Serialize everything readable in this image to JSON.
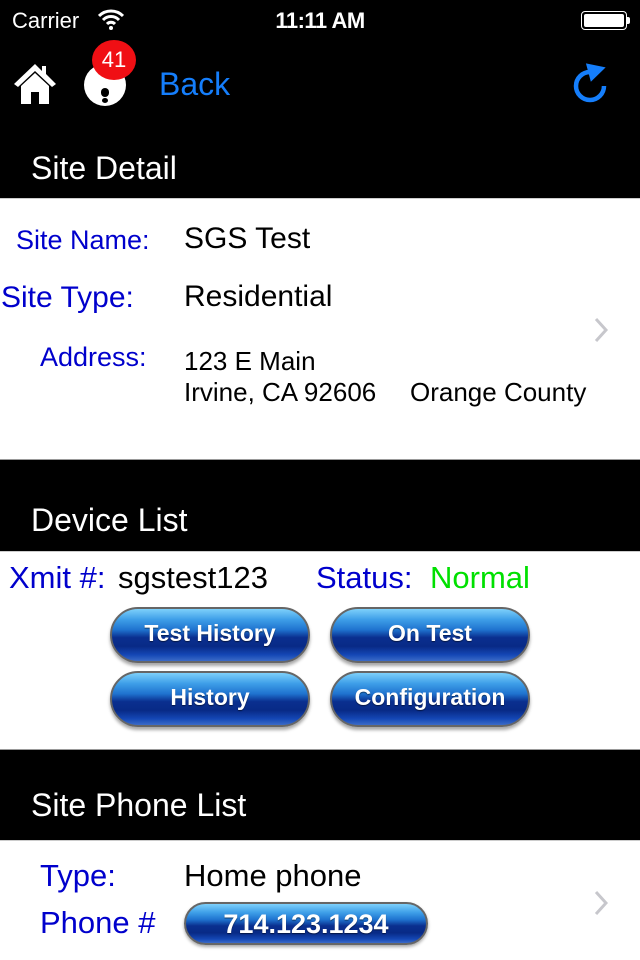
{
  "status_bar": {
    "carrier": "Carrier",
    "time": "11:11 AM",
    "wifi_icon": "wifi-icon",
    "battery_icon": "battery-icon"
  },
  "nav": {
    "home_icon": "home-icon",
    "alert_icon": "alert-icon",
    "alert_badge": "41",
    "back_label": "Back",
    "refresh_icon": "refresh-icon",
    "accent_color": "#157efb"
  },
  "site_detail": {
    "title": "Site Detail",
    "site_name_label": "Site Name:",
    "site_name": "SGS Test",
    "site_type_label": "Site Type:",
    "site_type": "Residential",
    "address_label": "Address:",
    "address_line1": "123 E Main",
    "address_line2": "Irvine, CA 92606",
    "county": "Orange County"
  },
  "device_list": {
    "title": "Device List",
    "xmit_label": "Xmit #:",
    "xmit_value": "sgstest123",
    "status_label": "Status:",
    "status_value": "Normal",
    "status_color": "#00e000",
    "buttons": [
      "Test History",
      "On Test",
      "History",
      "Configuration"
    ]
  },
  "phone_list": {
    "title": "Site Phone List",
    "type_label": "Type:",
    "type_value": "Home phone",
    "phone_label": "Phone #",
    "phone_value": "714.123.1234"
  }
}
